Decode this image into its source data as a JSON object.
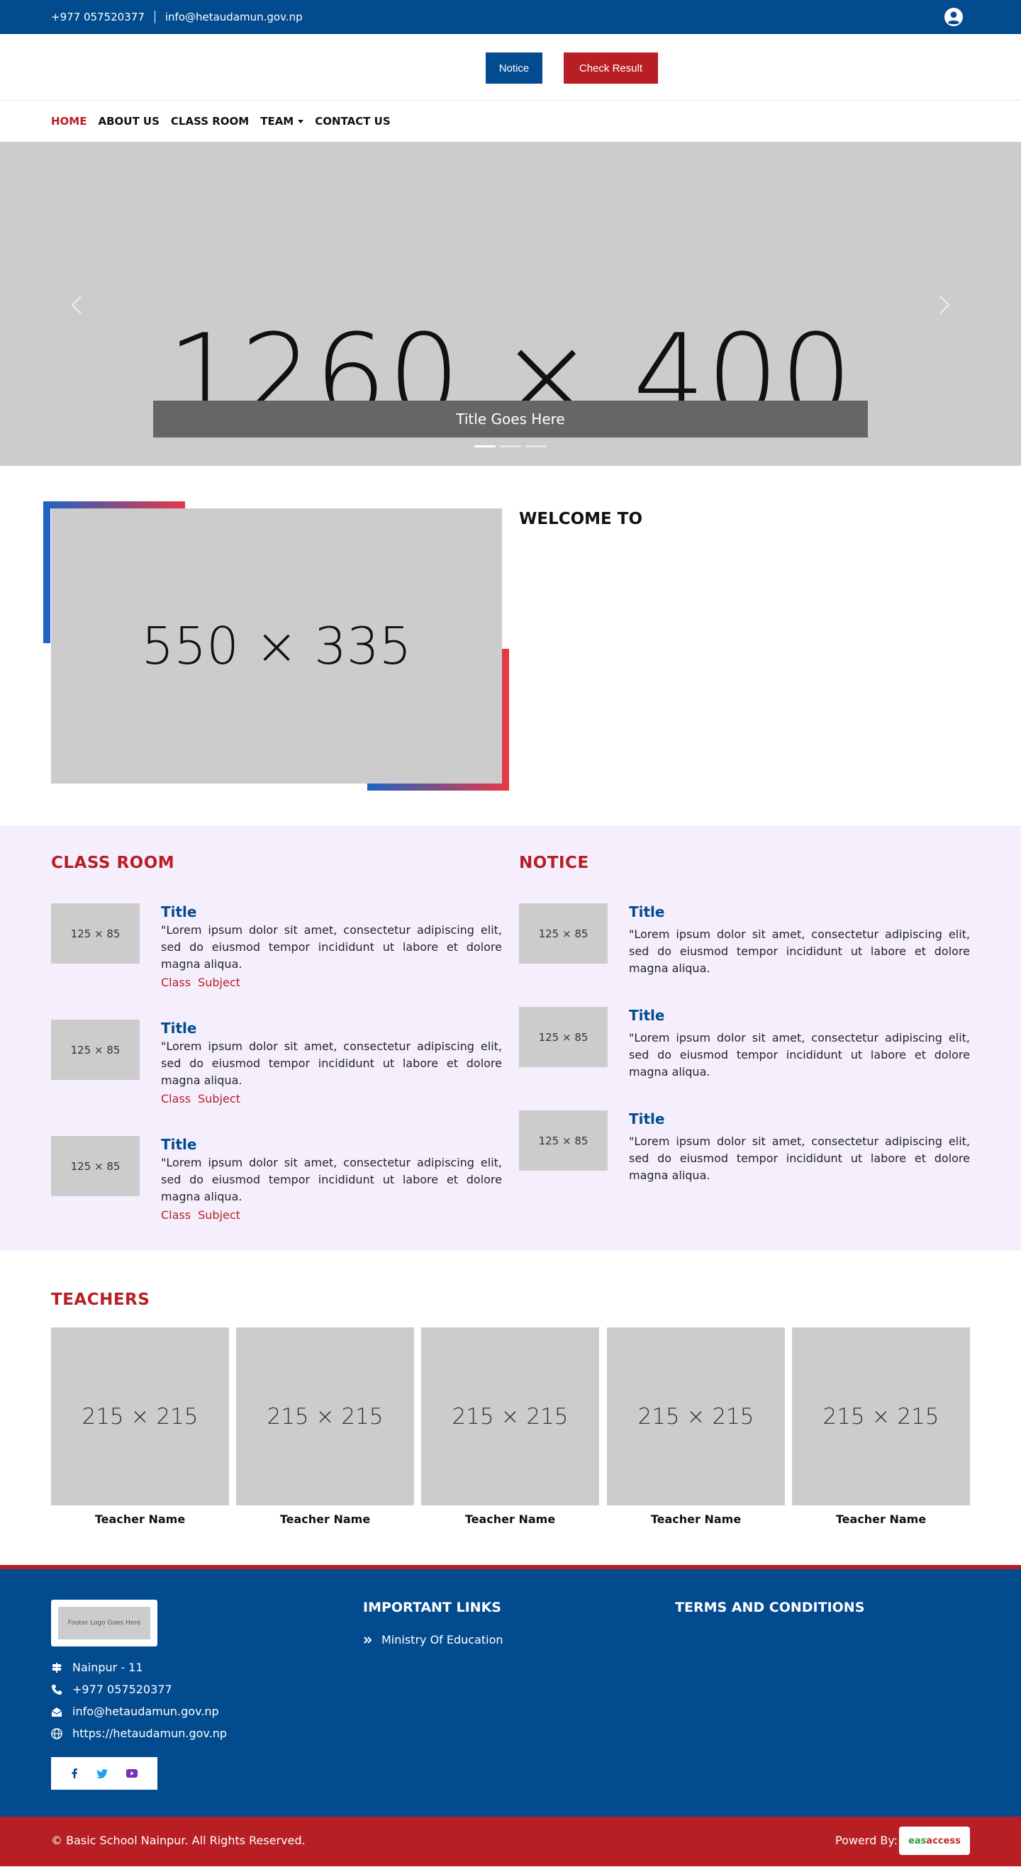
{
  "topbar": {
    "phone": "+977 057520377",
    "email": "info@hetaudamun.gov.np",
    "user_icon": "user-circle-icon"
  },
  "header": {
    "notice_label": "Notice",
    "result_label": "Check Result"
  },
  "nav": {
    "items": [
      {
        "label": "HOME",
        "active": true
      },
      {
        "label": "ABOUT US"
      },
      {
        "label": "CLASS ROOM"
      },
      {
        "label": "TEAM"
      },
      {
        "label": "CONTACT US"
      }
    ]
  },
  "hero": {
    "placeholder": "1260 × 400",
    "caption": "Title Goes Here",
    "slides": 3,
    "active_slide": 1
  },
  "welcome": {
    "image_placeholder": "550 × 335",
    "title": "WELCOME TO"
  },
  "classroom": {
    "title": "CLASS ROOM",
    "items": [
      {
        "thumb": "125 × 85",
        "title": "Title",
        "text": "\"Lorem ipsum dolor sit amet, consectetur adipiscing elit, sed do eiusmod tempor incididunt ut labore et dolore magna aliqua.",
        "class": "Class",
        "subject": "Subject"
      },
      {
        "thumb": "125 × 85",
        "title": "Title",
        "text": "\"Lorem ipsum dolor sit amet, consectetur adipiscing elit, sed do eiusmod tempor incididunt ut labore et dolore magna aliqua.",
        "class": "Class",
        "subject": "Subject"
      },
      {
        "thumb": "125 × 85",
        "title": "Title",
        "text": "\"Lorem ipsum dolor sit amet, consectetur adipiscing elit, sed do eiusmod tempor incididunt ut labore et dolore magna aliqua.",
        "class": "Class",
        "subject": "Subject"
      }
    ]
  },
  "notice": {
    "title": "NOTICE",
    "items": [
      {
        "thumb": "125 × 85",
        "title": "Title",
        "text": "\"Lorem ipsum dolor sit amet, consectetur adipiscing elit, sed do eiusmod tempor incididunt ut labore et dolore magna aliqua."
      },
      {
        "thumb": "125 × 85",
        "title": "Title",
        "text": "\"Lorem ipsum dolor sit amet, consectetur adipiscing elit, sed do eiusmod tempor incididunt ut labore et dolore magna aliqua."
      },
      {
        "thumb": "125 × 85",
        "title": "Title",
        "text": "\"Lorem ipsum dolor sit amet, consectetur adipiscing elit, sed do eiusmod tempor incididunt ut labore et dolore magna aliqua."
      }
    ]
  },
  "teachers": {
    "title": "TEACHERS",
    "items": [
      {
        "photo": "215 × 215",
        "name": "Teacher Name"
      },
      {
        "photo": "215 × 215",
        "name": "Teacher Name"
      },
      {
        "photo": "215 × 215",
        "name": "Teacher Name"
      },
      {
        "photo": "215 × 215",
        "name": "Teacher Name"
      },
      {
        "photo": "215 × 215",
        "name": "Teacher Name"
      }
    ]
  },
  "footer": {
    "logo_text": "Footer Logo Goes Here",
    "address": "Nainpur - 11",
    "phone": "+977 057520377",
    "email": "info@hetaudamun.gov.np",
    "website": "https://hetaudamun.gov.np",
    "important_links_title": "IMPORTANT LINKS",
    "links": [
      "Ministry Of Education"
    ],
    "terms_title": "TERMS AND CONDITIONS",
    "social": [
      "facebook-icon",
      "twitter-icon",
      "youtube-icon"
    ]
  },
  "bottombar": {
    "copyright": "© Basic School Nainpur. All Rights Reserved.",
    "powered_by": "Powerd By:",
    "brand_left": "eas",
    "brand_right": "access"
  },
  "colors": {
    "primary_blue": "#034b8f",
    "accent_red": "#b81f24",
    "placeholder_gray": "#cccccc",
    "section_bg": "#f5effd"
  }
}
